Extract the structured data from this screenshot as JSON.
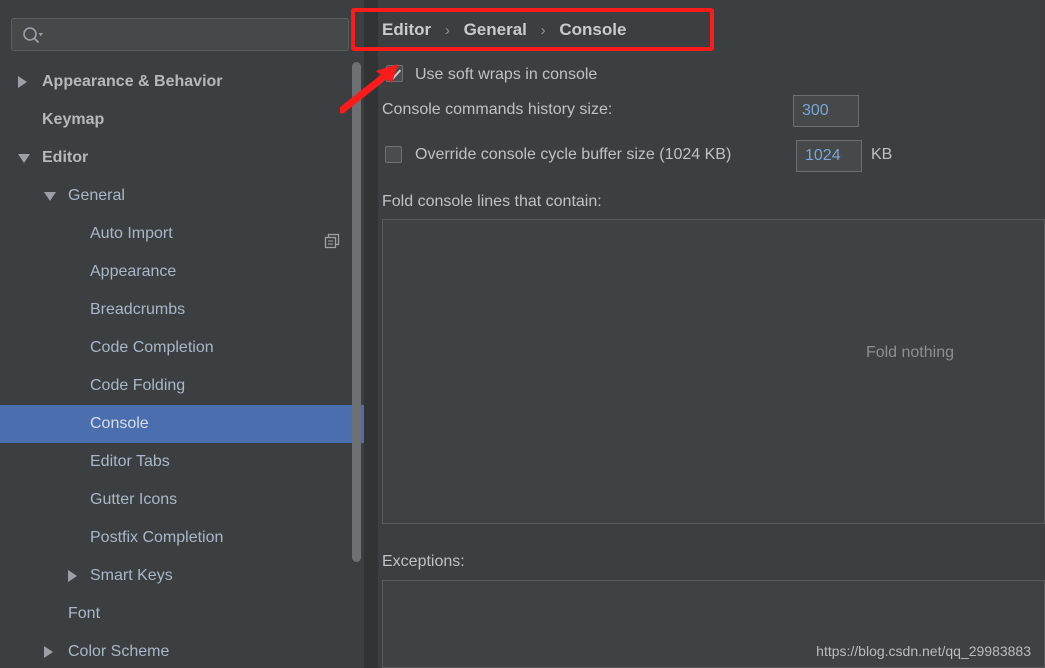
{
  "window": {
    "background": "#3c3f41",
    "accent": "#4b6eaf",
    "annotation_color": "#fc1b1b"
  },
  "search": {
    "value": "",
    "placeholder": "",
    "icon": "search-icon"
  },
  "sidebar": {
    "items": [
      {
        "label": "Appearance & Behavior",
        "level": 0,
        "twisty": "collapsed",
        "selected": false
      },
      {
        "label": "Keymap",
        "level": 0,
        "twisty": "none",
        "selected": false
      },
      {
        "label": "Editor",
        "level": 0,
        "twisty": "expanded",
        "selected": false
      },
      {
        "label": "General",
        "level": 1,
        "twisty": "expanded",
        "selected": false
      },
      {
        "label": "Auto Import",
        "level": 2,
        "twisty": "none",
        "selected": false,
        "trailing_icon": "copy-icon"
      },
      {
        "label": "Appearance",
        "level": 2,
        "twisty": "none",
        "selected": false
      },
      {
        "label": "Breadcrumbs",
        "level": 2,
        "twisty": "none",
        "selected": false
      },
      {
        "label": "Code Completion",
        "level": 2,
        "twisty": "none",
        "selected": false
      },
      {
        "label": "Code Folding",
        "level": 2,
        "twisty": "none",
        "selected": false
      },
      {
        "label": "Console",
        "level": 2,
        "twisty": "none",
        "selected": true
      },
      {
        "label": "Editor Tabs",
        "level": 2,
        "twisty": "none",
        "selected": false
      },
      {
        "label": "Gutter Icons",
        "level": 2,
        "twisty": "none",
        "selected": false
      },
      {
        "label": "Postfix Completion",
        "level": 2,
        "twisty": "none",
        "selected": false
      },
      {
        "label": "Smart Keys",
        "level": 2,
        "twisty": "collapsed",
        "selected": false
      },
      {
        "label": "Font",
        "level": 1,
        "twisty": "none",
        "selected": false
      },
      {
        "label": "Color Scheme",
        "level": 1,
        "twisty": "collapsed",
        "selected": false
      }
    ]
  },
  "breadcrumb": {
    "parts": [
      "Editor",
      "General",
      "Console"
    ],
    "separator": "›"
  },
  "settings": {
    "soft_wraps": {
      "label": "Use soft wraps in console",
      "checked": true
    },
    "history_size": {
      "label": "Console commands history size:",
      "value": "300"
    },
    "override_buffer": {
      "label": "Override console cycle buffer size (1024 KB)",
      "checked": false,
      "value": "1024",
      "unit": "KB"
    },
    "fold_lines": {
      "label": "Fold console lines that contain:",
      "placeholder": "Fold nothing",
      "value": ""
    },
    "exceptions": {
      "label": "Exceptions:",
      "value": ""
    }
  },
  "watermark": {
    "text": "https://blog.csdn.net/qq_29983883"
  }
}
